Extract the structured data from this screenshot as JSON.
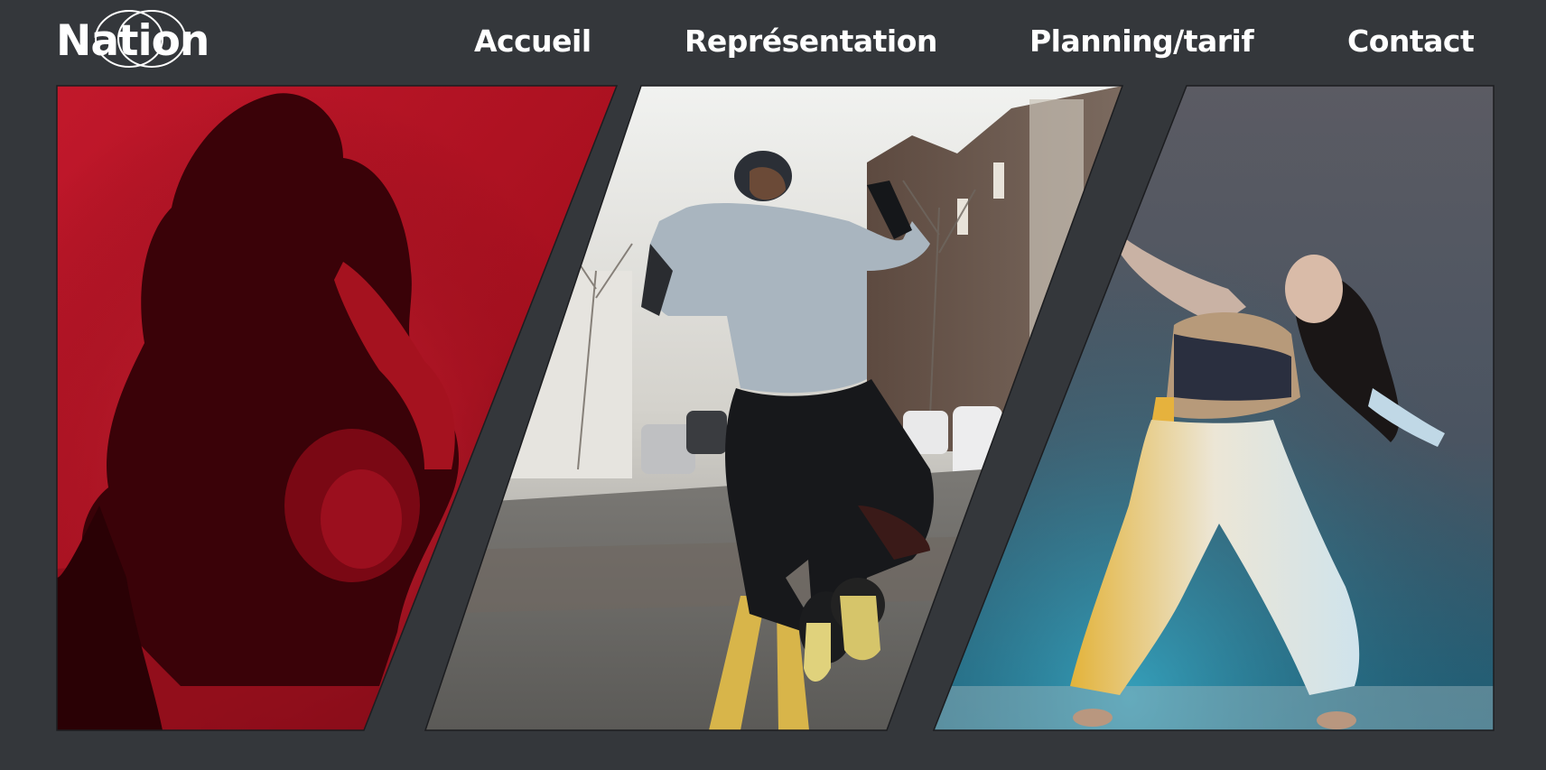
{
  "brand": {
    "name": "Nation",
    "logo_icon": "overlapping-circles-icon"
  },
  "nav": {
    "items": [
      {
        "label": "Accueil"
      },
      {
        "label": "Représentation"
      },
      {
        "label": "Planning/tarif"
      },
      {
        "label": "Contact"
      }
    ]
  },
  "gallery": {
    "panels": [
      {
        "subject": "couple-dance-red-photo",
        "accent": "#c8102e"
      },
      {
        "subject": "street-dance-jump-photo",
        "accent": "#8a8c8e"
      },
      {
        "subject": "contemporary-dancer-photo",
        "accent": "#1f6f86"
      }
    ]
  },
  "colors": {
    "background": "#34373b",
    "text": "#ffffff"
  }
}
